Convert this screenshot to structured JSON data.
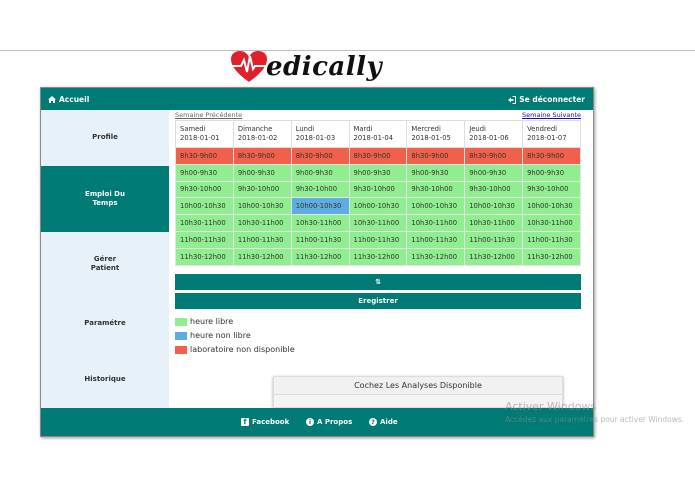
{
  "brand": {
    "logo_text": "edically"
  },
  "navbar": {
    "home_label": "Accueil",
    "logout_label": "Se déconnecter"
  },
  "sidebar": {
    "items": [
      {
        "label": "Profile"
      },
      {
        "label": "Emploi Du\nTemps"
      },
      {
        "label": "Gérer\nPatient"
      },
      {
        "label": "Paramétre"
      },
      {
        "label": "Historique"
      }
    ]
  },
  "week_nav": {
    "prev_label": "Semaine Précédente",
    "next_label": "Semaine Suivante"
  },
  "schedule": {
    "days": [
      {
        "name": "Samedi",
        "date": "2018-01-01"
      },
      {
        "name": "Dimanche",
        "date": "2018-01-02"
      },
      {
        "name": "Lundi",
        "date": "2018-01-03"
      },
      {
        "name": "Mardi",
        "date": "2018-01-04"
      },
      {
        "name": "Mercredi",
        "date": "2018-01-05"
      },
      {
        "name": "Jeudi",
        "date": "2018-01-06"
      },
      {
        "name": "Vendredi",
        "date": "2018-01-07"
      }
    ],
    "rows": [
      {
        "time": "8h30-9h00",
        "states": [
          "lab",
          "lab",
          "lab",
          "lab",
          "lab",
          "lab",
          "lab"
        ]
      },
      {
        "time": "9h00-9h30",
        "states": [
          "free",
          "free",
          "free",
          "free",
          "free",
          "free",
          "free"
        ]
      },
      {
        "time": "9h30-10h00",
        "states": [
          "free",
          "free",
          "free",
          "free",
          "free",
          "free",
          "free"
        ]
      },
      {
        "time": "10h00-10h30",
        "states": [
          "free",
          "free",
          "busy",
          "free",
          "free",
          "free",
          "free"
        ]
      },
      {
        "time": "10h30-11h00",
        "states": [
          "free",
          "free",
          "free",
          "free",
          "free",
          "free",
          "free"
        ]
      },
      {
        "time": "11h00-11h30",
        "states": [
          "free",
          "free",
          "free",
          "free",
          "free",
          "free",
          "free"
        ]
      },
      {
        "time": "11h30-12h00",
        "states": [
          "free",
          "free",
          "free",
          "free",
          "free",
          "free",
          "free"
        ]
      }
    ]
  },
  "buttons": {
    "swap_label": "⇅",
    "save_label": "Eregistrer"
  },
  "legend": {
    "items": [
      {
        "label": "heure libre",
        "color": "#90ee90"
      },
      {
        "label": "heure non libre",
        "color": "#5dade2"
      },
      {
        "label": "laboratoire non disponible",
        "color": "#f1604a"
      }
    ]
  },
  "analyses_panel": {
    "title": "Cochez Les Analyses Disponible"
  },
  "footer": {
    "facebook_label": "Facebook",
    "about_label": "A Propos",
    "help_label": "Aide"
  },
  "watermark": {
    "line1": "Activer Windows",
    "line2": "Accédez aux paramètres pour activer Windows."
  },
  "colors": {
    "primary": "#007a74",
    "sidebar_bg": "#e6f1fa",
    "free": "#90ee90",
    "busy": "#5dade2",
    "lab": "#f1604a"
  }
}
